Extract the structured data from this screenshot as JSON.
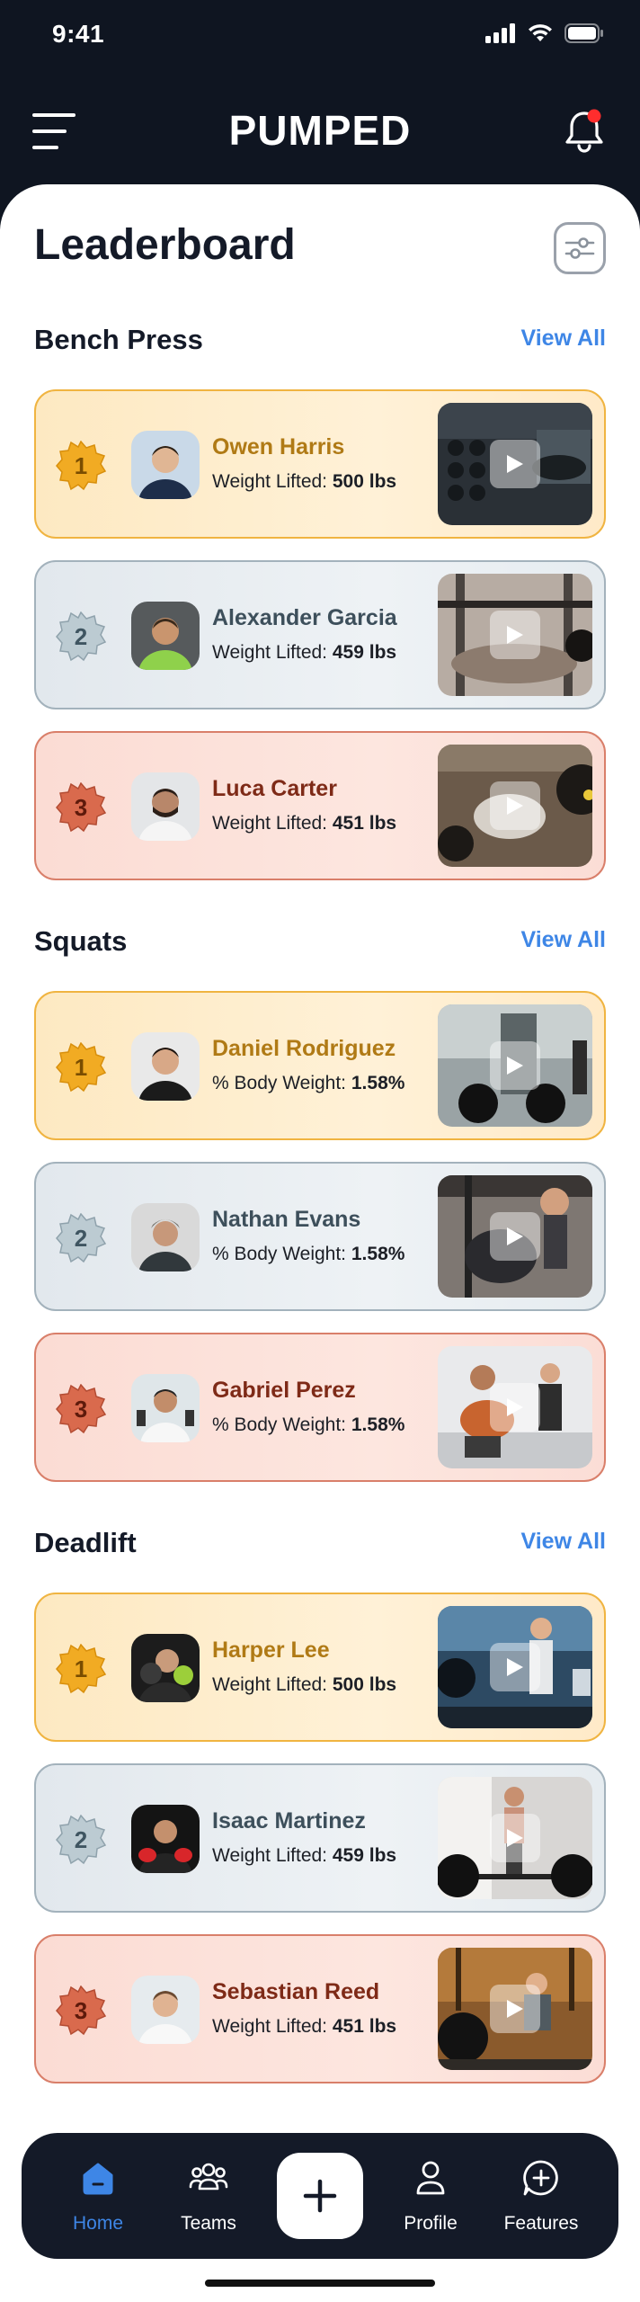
{
  "status_bar": {
    "time": "9:41"
  },
  "header": {
    "title": "PUMPED",
    "has_notification": true
  },
  "page": {
    "title": "Leaderboard"
  },
  "sections": [
    {
      "title": "Bench Press",
      "view_all": "View All",
      "entries": [
        {
          "rank": "1",
          "tier": "gold",
          "name": "Owen Harris",
          "stat_label": "Weight Lifted:",
          "stat_value": "500 lbs"
        },
        {
          "rank": "2",
          "tier": "silver",
          "name": "Alexander Garcia",
          "stat_label": "Weight Lifted:",
          "stat_value": "459 lbs"
        },
        {
          "rank": "3",
          "tier": "bronze",
          "name": "Luca Carter",
          "stat_label": "Weight Lifted:",
          "stat_value": "451 lbs"
        }
      ]
    },
    {
      "title": "Squats",
      "view_all": "View All",
      "entries": [
        {
          "rank": "1",
          "tier": "gold",
          "name": "Daniel Rodriguez",
          "stat_label": "% Body Weight:",
          "stat_value": "1.58%"
        },
        {
          "rank": "2",
          "tier": "silver",
          "name": "Nathan Evans",
          "stat_label": "% Body Weight:",
          "stat_value": "1.58%"
        },
        {
          "rank": "3",
          "tier": "bronze",
          "name": "Gabriel Perez",
          "stat_label": "% Body Weight:",
          "stat_value": "1.58%"
        }
      ]
    },
    {
      "title": "Deadlift",
      "view_all": "View All",
      "entries": [
        {
          "rank": "1",
          "tier": "gold",
          "name": "Harper Lee",
          "stat_label": "Weight Lifted:",
          "stat_value": "500 lbs"
        },
        {
          "rank": "2",
          "tier": "silver",
          "name": "Isaac Martinez",
          "stat_label": "Weight Lifted:",
          "stat_value": "459 lbs"
        },
        {
          "rank": "3",
          "tier": "bronze",
          "name": "Sebastian Reed",
          "stat_label": "Weight Lifted:",
          "stat_value": "451 lbs"
        }
      ]
    }
  ],
  "bottom_nav": {
    "items": [
      {
        "label": "Home",
        "icon": "home-icon",
        "active": true
      },
      {
        "label": "Teams",
        "icon": "teams-icon",
        "active": false
      },
      {
        "label": "Profile",
        "icon": "profile-icon",
        "active": false
      },
      {
        "label": "Features",
        "icon": "features-icon",
        "active": false
      }
    ],
    "add_icon": "plus-icon"
  },
  "colors": {
    "background_dark": "#0f1521",
    "accent_blue": "#3e86e6",
    "gold": "#f0b441",
    "silver": "#a3b2bc",
    "bronze": "#d97f6a",
    "notification_dot": "#ff2d2d"
  }
}
